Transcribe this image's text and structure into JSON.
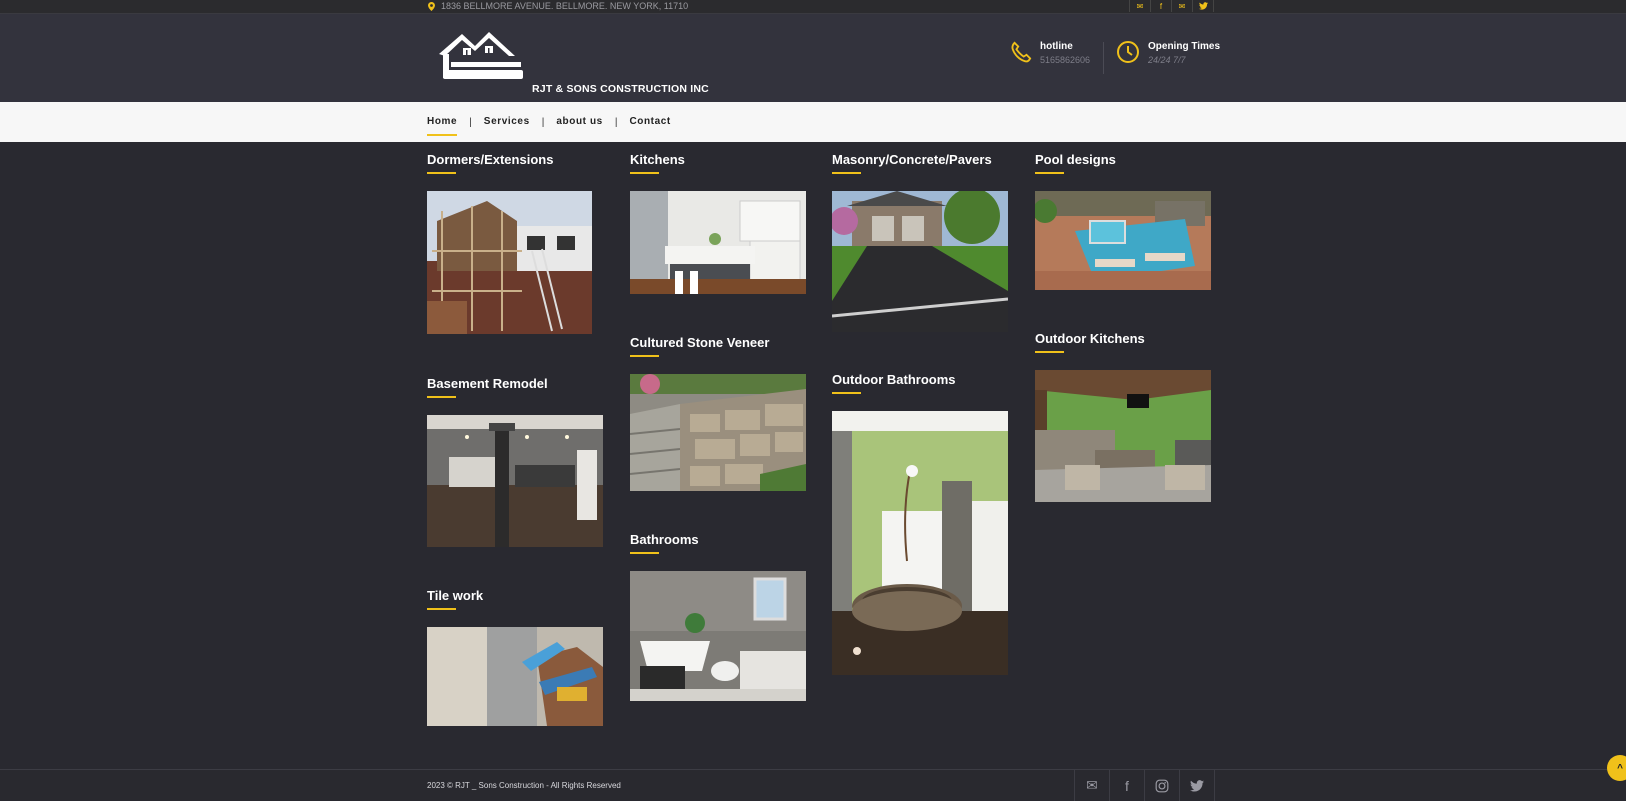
{
  "topbar": {
    "address": "1836 BELLMORE AVENUE. BELLMORE. NEW YORK, 11710",
    "icons": [
      "envelope-icon",
      "facebook-icon",
      "envelope-icon",
      "twitter-icon"
    ]
  },
  "header": {
    "logo_text": "RJT & SONS CONSTRUCTION INC",
    "hotline_label": "hotline",
    "hotline_value": "5165862606",
    "hours_label": "Opening Times",
    "hours_value": "24/24 7/7"
  },
  "nav": {
    "items": [
      "Home",
      "Services",
      "about us",
      "Contact"
    ],
    "active": "Home"
  },
  "services": {
    "dormers": "Dormers/Extensions",
    "kitchens": "Kitchens",
    "masonry": "Masonry/Concrete/Pavers",
    "pool": "Pool designs",
    "basement": "Basement Remodel",
    "stone": "Cultured Stone Veneer",
    "outdoor_bath": "Outdoor Bathrooms",
    "outdoor_kitchen": "Outdoor Kitchens",
    "bathrooms": "Bathrooms",
    "tile": "Tile work"
  },
  "footer": {
    "copyright": "2023 © RJT _ Sons Construction - All Rights Reserved",
    "icons": [
      "envelope-icon",
      "facebook-icon",
      "instagram-icon",
      "twitter-icon"
    ],
    "back_to_top": "^"
  },
  "colors": {
    "accent": "#f0c11a",
    "background": "#292930",
    "header": "#33333d",
    "nav": "#f7f7f7"
  }
}
